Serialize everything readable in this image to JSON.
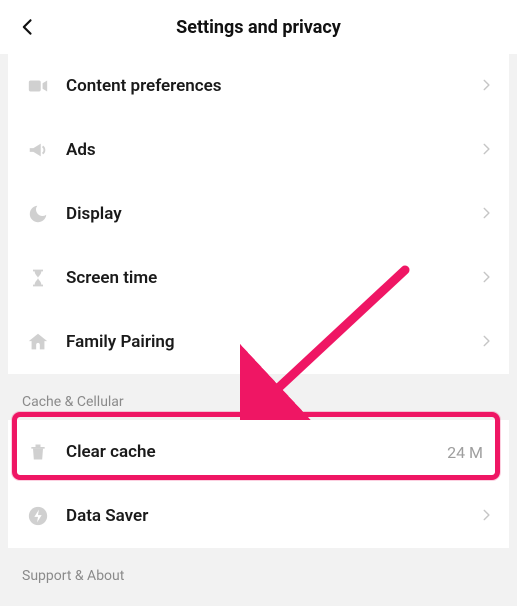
{
  "header": {
    "title": "Settings and privacy"
  },
  "group1": {
    "items": [
      {
        "id": "content-prefs",
        "icon": "video-icon",
        "label": "Content preferences"
      },
      {
        "id": "ads",
        "icon": "megaphone-icon",
        "label": "Ads"
      },
      {
        "id": "display",
        "icon": "moon-icon",
        "label": "Display"
      },
      {
        "id": "screen-time",
        "icon": "hourglass-icon",
        "label": "Screen time"
      },
      {
        "id": "family-pairing",
        "icon": "home-icon",
        "label": "Family Pairing"
      }
    ]
  },
  "section2": {
    "title": "Cache & Cellular"
  },
  "group2": {
    "items": [
      {
        "id": "clear-cache",
        "icon": "trash-icon",
        "label": "Clear cache",
        "value": "24 M",
        "has_chevron": false
      },
      {
        "id": "data-saver",
        "icon": "bolt-icon",
        "label": "Data Saver",
        "value": "",
        "has_chevron": true
      }
    ]
  },
  "section3": {
    "title": "Support & About"
  },
  "annotation": {
    "color": "#ef1664"
  }
}
